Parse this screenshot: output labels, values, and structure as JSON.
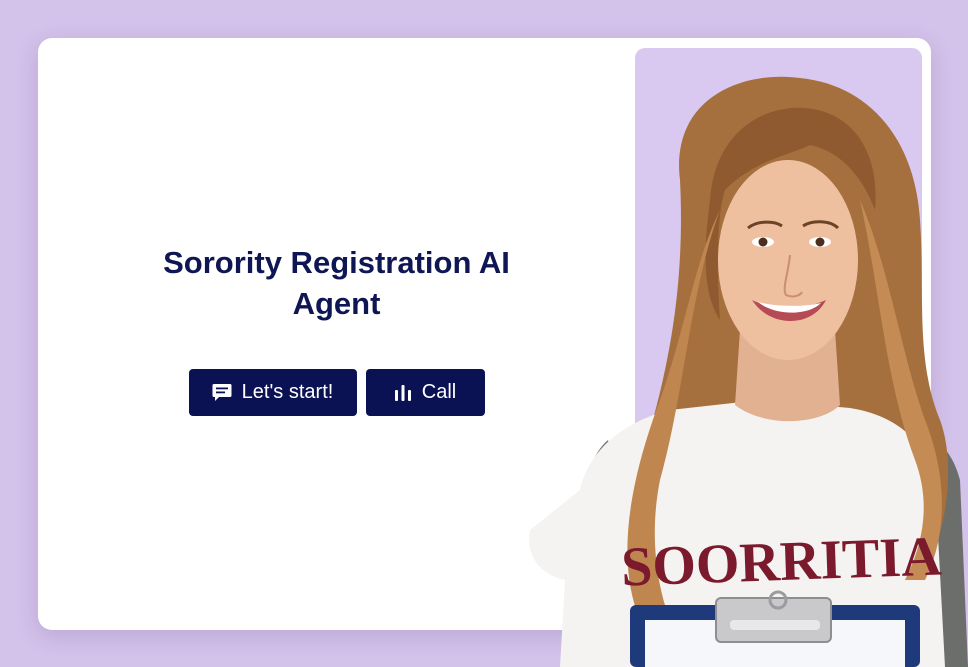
{
  "hero": {
    "title": "Sorority Registration AI Agent",
    "start_button": {
      "label": "Let's start!",
      "icon": "chat-icon"
    },
    "call_button": {
      "label": "Call",
      "icon": "voice-bars-icon"
    }
  },
  "portrait": {
    "shirt_text": "SOORRITIA"
  },
  "colors": {
    "page_background": "#d3c2ea",
    "card_background": "#ffffff",
    "title_color": "#0f1654",
    "button_background": "#0b1254",
    "button_text": "#ffffff",
    "photo_panel": "#d9c9f0"
  }
}
